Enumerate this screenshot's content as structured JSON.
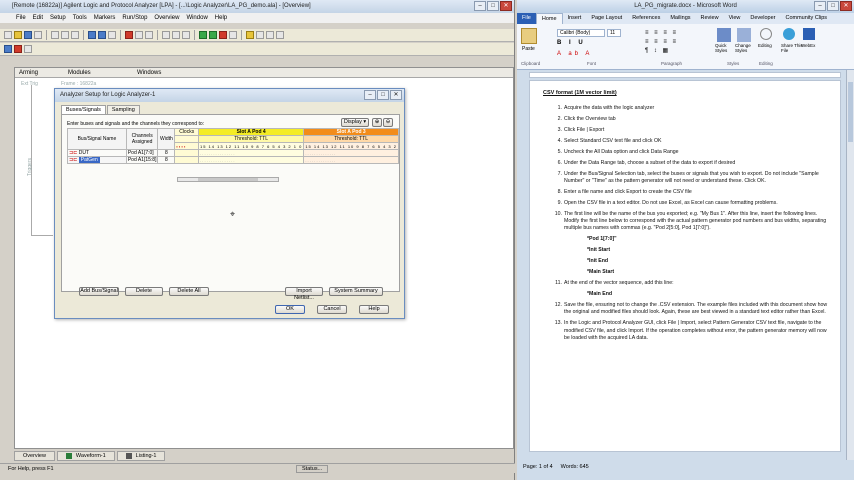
{
  "la": {
    "title": "[Remote (16822a)] Agilent Logic and Protocol Analyzer [LPA] - [...\\Logic Analyzer\\LA_PG_demo.ala] - [Overview]",
    "menu": [
      "File",
      "Edit",
      "Setup",
      "Tools",
      "Markers",
      "Run/Stop",
      "Overview",
      "Window",
      "Help"
    ],
    "ws_headers": [
      "Arming",
      "Modules",
      "Windows"
    ],
    "frame_label": "Frame : 16822a",
    "ext_trig": "Ext Trig",
    "triggers": "Triggers",
    "tabs": [
      "Overview",
      "Waveform-1",
      "Listing-1"
    ],
    "status_left": "For Help, press F1",
    "status_mid": "Status..."
  },
  "dialog": {
    "title": "Analyzer Setup for Logic Analyzer-1",
    "tabs": [
      "Buses/Signals",
      "Sampling"
    ],
    "instruction": "Enter buses and signals and the channels they correspond to:",
    "display_label": "Display",
    "col_bus": "Bus/Signal Name",
    "col_channels": "Channels Assigned",
    "col_width": "Width",
    "col_clocks": "Clocks",
    "slot_a": "Slot A Pod 4",
    "slot_a_thresh": "Threshold: TTL",
    "slot_b": "Slot A Pod 3",
    "slot_b_thresh": "Threshold: TTL",
    "rows": [
      {
        "name": "DUT",
        "channels": "Pod A1[7:0]",
        "width": "8"
      },
      {
        "name": "PatGen",
        "channels": "Pod A1[15:8]",
        "width": "8"
      }
    ],
    "btn_add": "Add Bus/Signal",
    "btn_delete": "Delete",
    "btn_delete_all": "Delete All",
    "btn_import": "Import Netlist...",
    "btn_summary": "System Summary",
    "btn_ok": "OK",
    "btn_cancel": "Cancel",
    "btn_help": "Help"
  },
  "word": {
    "title": "LA_PG_migrate.docx - Microsoft Word",
    "ribbon_tabs": [
      "File",
      "Home",
      "Insert",
      "Page Layout",
      "References",
      "Mailings",
      "Review",
      "View",
      "Developer",
      "Community Clips"
    ],
    "font_name": "Calibri (Body)",
    "font_size": "11",
    "groups": [
      "Clipboard",
      "Font",
      "Paragraph",
      "Styles",
      "Editing"
    ],
    "ribbon_buttons": [
      "Paste",
      "Quick Styles",
      "Change Styles",
      "Editing",
      "Share This File",
      "WebEx"
    ],
    "heading": "CSV format (1M vector limit)",
    "steps": [
      {
        "n": "1.",
        "t": "Acquire the data with the logic analyzer"
      },
      {
        "n": "2.",
        "t": "Click the Overview tab"
      },
      {
        "n": "3.",
        "t": "Click File | Export"
      },
      {
        "n": "4.",
        "t": "Select Standard CSV text file and click OK"
      },
      {
        "n": "5.",
        "t": "Uncheck the All Data option and click Data Range"
      },
      {
        "n": "6.",
        "t": "Under the Data Range tab, choose a subset of the data to export if desired"
      },
      {
        "n": "7.",
        "t": "Under the Bus/Signal Selection tab, select the buses or signals that you wish to export. Do not include \"Sample Number\" or \"Time\" as the pattern generator will not need or understand these. Click OK."
      },
      {
        "n": "8.",
        "t": "Enter a file name and click Export to create the CSV file"
      },
      {
        "n": "9.",
        "t": "Open the CSV file in a text editor. Do not use Excel, as Excel can cause formatting problems."
      },
      {
        "n": "10.",
        "t": "The first line will be the name of the bus you exported; e.g. \"My Bus 1\". After this line, insert the following lines. Modify the first line below to correspond with the actual pattern generator pod numbers and bus widths, separating multiple bus names with commas (e.g. \"Pod 2[5:0], Pod 1[7:0]\")."
      }
    ],
    "code_lines": [
      "*Pod 1[7:0]\"",
      "*Init Start",
      "*Init End",
      "*Main Start"
    ],
    "step11": {
      "n": "11.",
      "t": "At the end of the vector sequence, add this line:"
    },
    "code_end": "*Main End",
    "step12": {
      "n": "12.",
      "t": "Save the file, ensuring not to change the .CSV extension. The example files included with this document show how the original and modified files should look. Again, these are best viewed in a standard text editor rather than Excel."
    },
    "step13": {
      "n": "13.",
      "t": "In the Logic and Protocol Analyzer GUI, click File | Import, select Pattern Generator CSV text file, navigate to the modified CSV file, and click Import. If the operation completes without error, the pattern generator memory will now be loaded with the acquired LA data."
    },
    "status": [
      "Page: 1 of 4",
      "Words: 645"
    ]
  }
}
